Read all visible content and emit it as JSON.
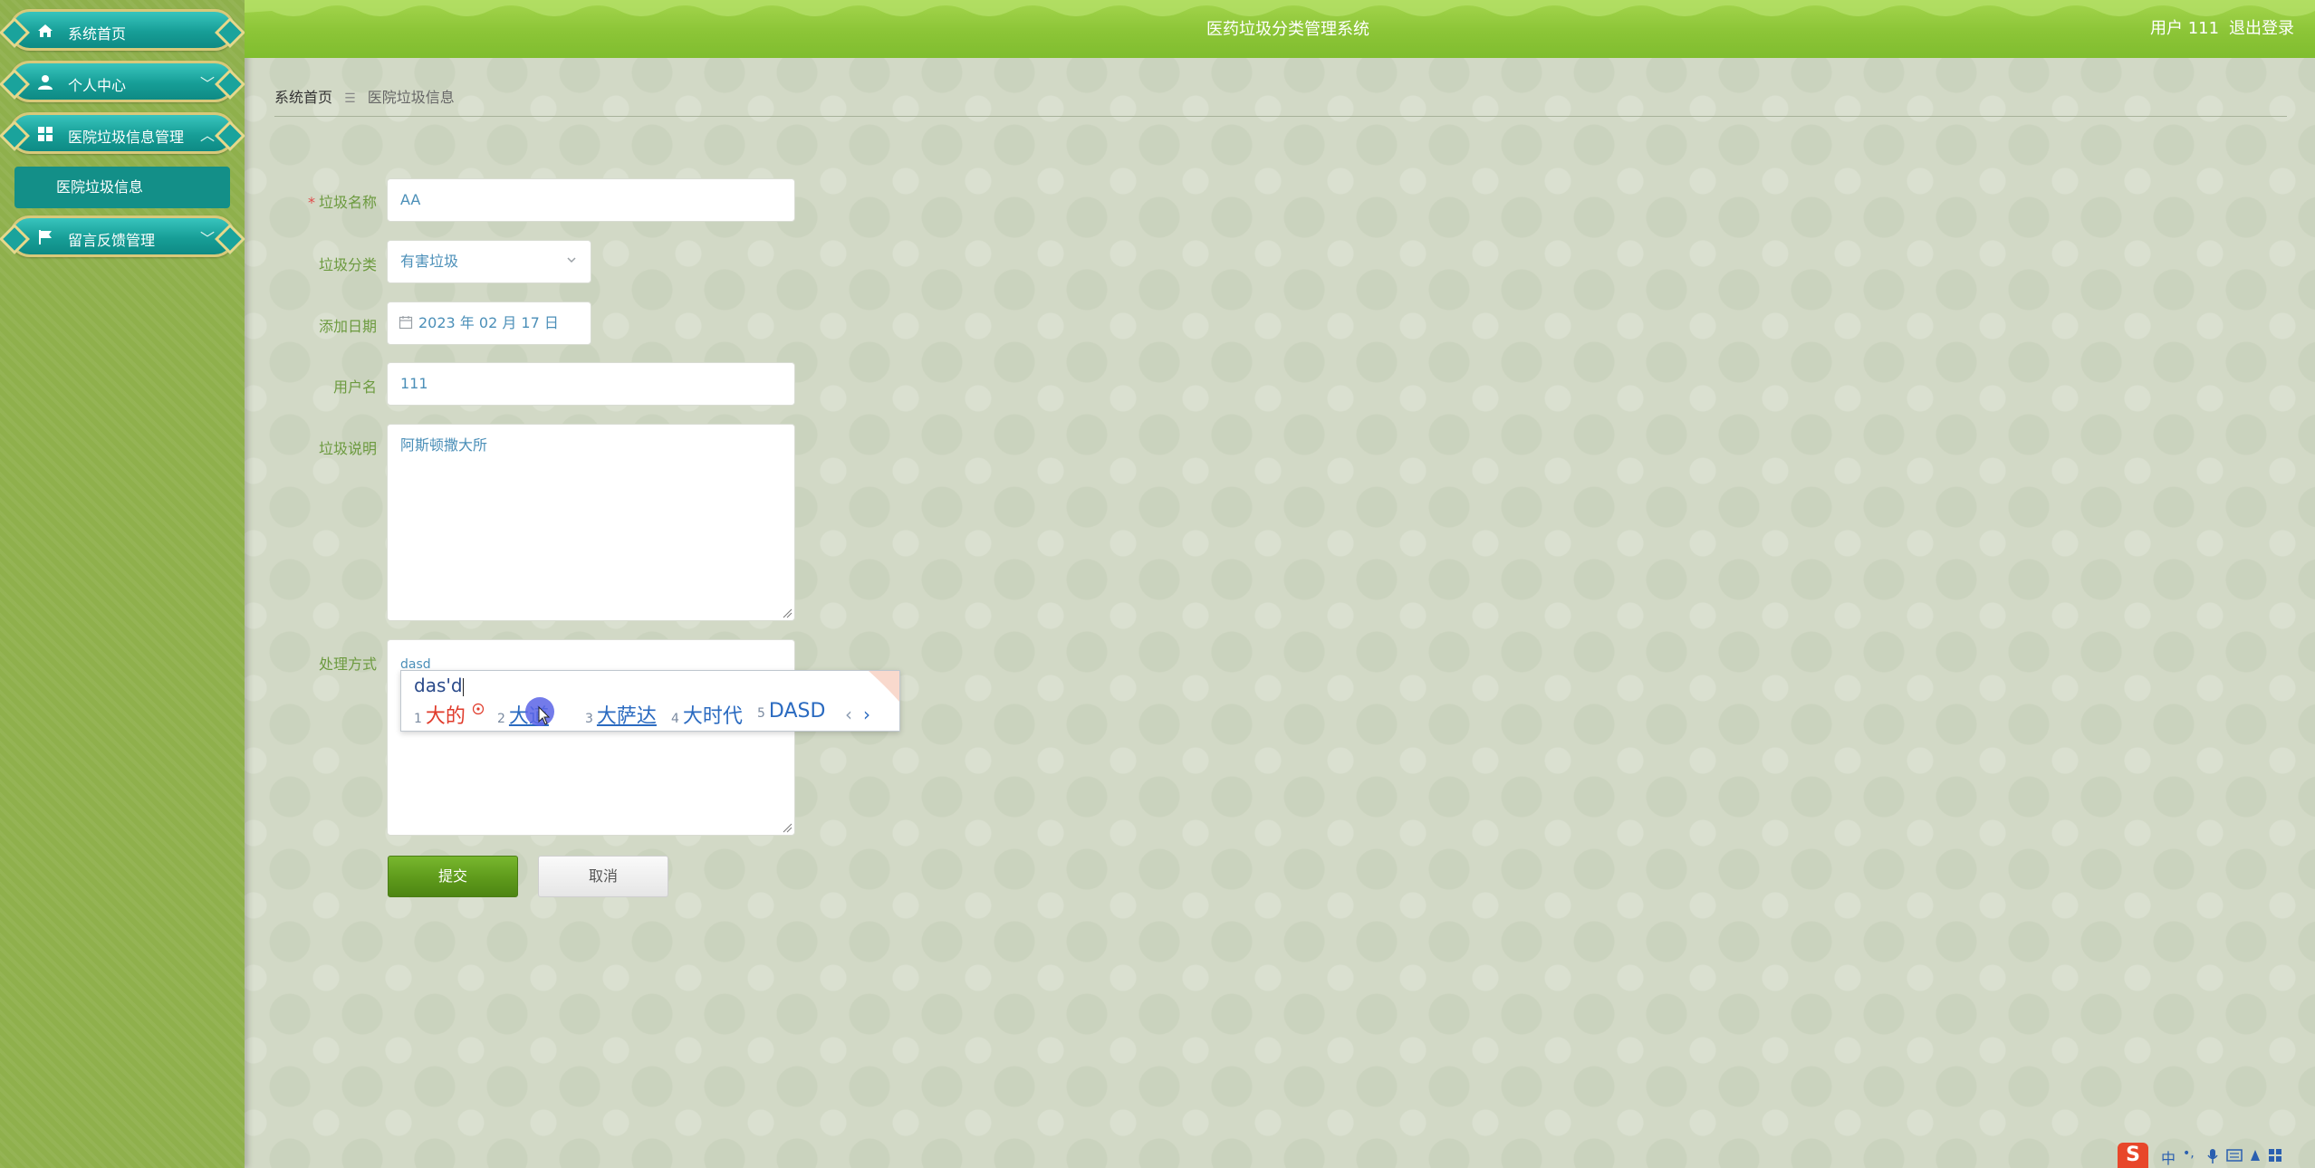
{
  "header": {
    "app_title": "医药垃圾分类管理系统",
    "user_label": "用户 111",
    "logout_label": "退出登录"
  },
  "sidebar": {
    "items": [
      {
        "label": "系统首页",
        "icon": "home-icon"
      },
      {
        "label": "个人中心",
        "icon": "user-icon",
        "chevron": "﹀"
      },
      {
        "label": "医院垃圾信息管理",
        "icon": "grid-icon",
        "chevron": "︿"
      },
      {
        "label": "留言反馈管理",
        "icon": "flag-icon",
        "chevron": "﹀"
      }
    ],
    "sub_items": [
      {
        "label": "医院垃圾信息"
      }
    ]
  },
  "breadcrumb": {
    "home": "系统首页",
    "separator": "☰",
    "current": "医院垃圾信息"
  },
  "form": {
    "required_mark": "*",
    "name": {
      "label": "垃圾名称",
      "value": "AA"
    },
    "category": {
      "label": "垃圾分类",
      "value": "有害垃圾"
    },
    "date": {
      "label": "添加日期",
      "value": "2023 年 02 月 17 日"
    },
    "username": {
      "label": "用户名",
      "value": "111"
    },
    "description": {
      "label": "垃圾说明",
      "value": "阿斯顿撒大所"
    },
    "method": {
      "label": "处理方式",
      "value": "dasd"
    },
    "submit_label": "提交",
    "cancel_label": "取消"
  },
  "ime": {
    "composition": "das'd",
    "candidates": [
      {
        "num": "1",
        "text": "大的"
      },
      {
        "num": "2",
        "text": "大道"
      },
      {
        "num": "3",
        "text": "大萨达"
      },
      {
        "num": "4",
        "text": "大时代"
      },
      {
        "num": "5",
        "text": "DASD"
      }
    ],
    "prev_glyph": "‹",
    "next_glyph": "›"
  },
  "tray": {
    "logo": "S",
    "lang": "中",
    "punct": "•,"
  },
  "colors": {
    "header_green": "#8cc537",
    "sidebar_green": "#8fb04c",
    "nav_teal": "#179e97",
    "label_green": "#6c9a3f",
    "input_text_blue": "#4b8fb8",
    "submit_green": "#5e9a1b"
  }
}
